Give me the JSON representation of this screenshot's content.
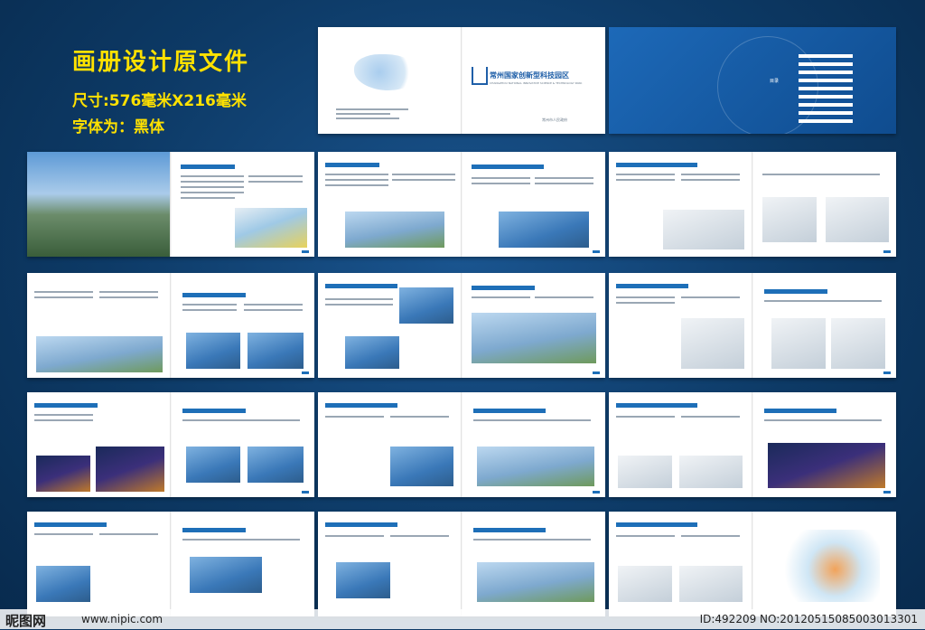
{
  "header": {
    "title": "画册设计原文件",
    "size": "尺寸:576毫米X216毫米",
    "font": "字体为：黑体"
  },
  "cover": {
    "park_name": "常州国家创新型科技园区",
    "park_name_en": "CHANGZHOU NATIONAL INNOVATIVE SCIENCE & TECHNOLOGY PARK",
    "publisher": "常州市人民政府"
  },
  "toc": {
    "label": "目录"
  },
  "watermark": {
    "logo": "昵图网",
    "url": "www.nipic.com",
    "id_text": "ID:492209 NO:20120515085003013301"
  },
  "colors": {
    "background": "#0d3a66",
    "title": "#ffe100",
    "accent": "#1e6fb8"
  }
}
